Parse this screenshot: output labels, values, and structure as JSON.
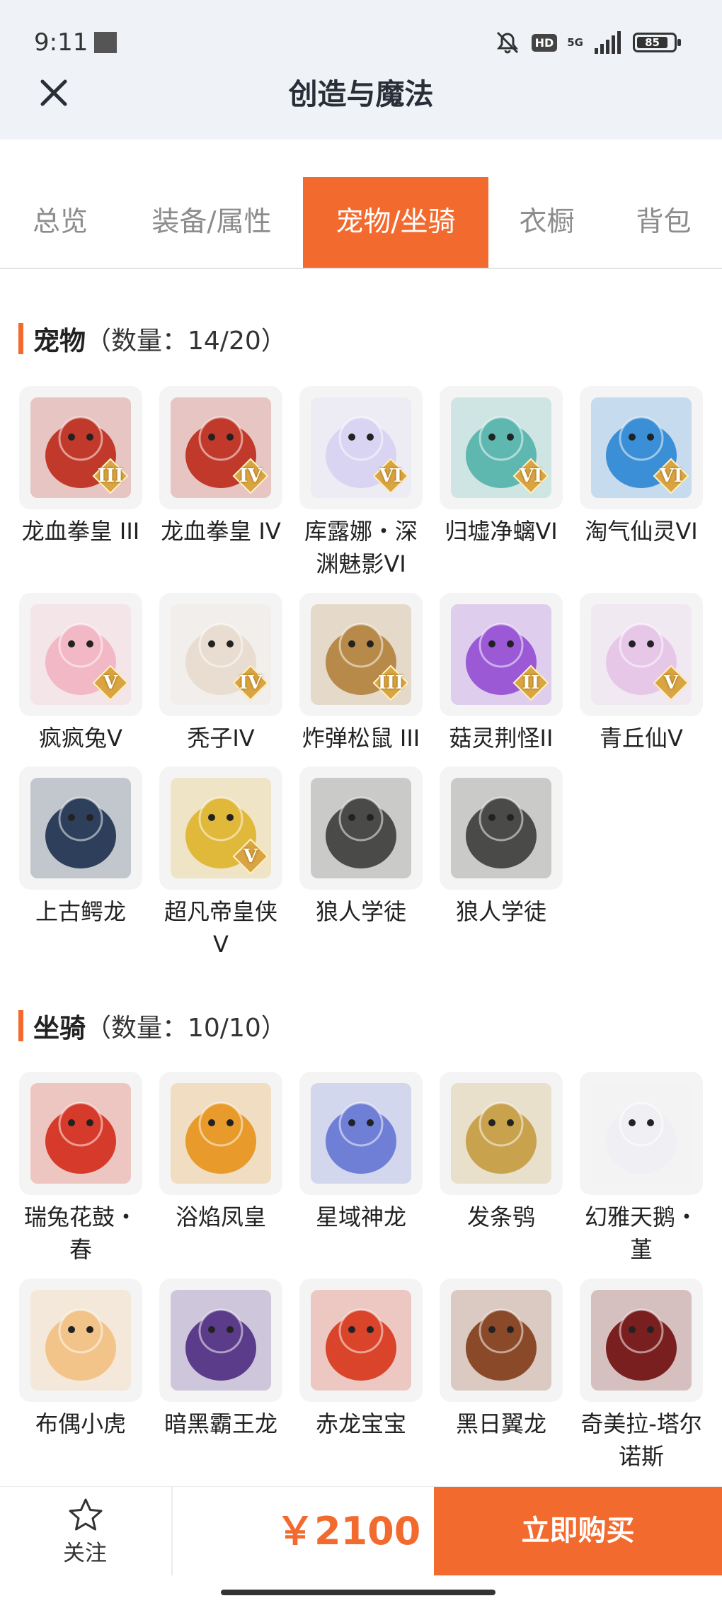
{
  "status_bar": {
    "time": "9:11",
    "hd": "HD",
    "network": "5G",
    "battery": "85"
  },
  "header": {
    "title": "创造与魔法"
  },
  "tabs": [
    {
      "label": "总览",
      "active": false
    },
    {
      "label": "装备/属性",
      "active": false
    },
    {
      "label": "宠物/坐骑",
      "active": true
    },
    {
      "label": "衣橱",
      "active": false
    },
    {
      "label": "背包",
      "active": false
    }
  ],
  "pets": {
    "title": "宠物",
    "count": "（数量：14/20）",
    "items": [
      {
        "name": "龙血拳皇 III",
        "grade": "III",
        "icon": "red-horned-beast-icon",
        "color": "#c0392b"
      },
      {
        "name": "龙血拳皇 IV",
        "grade": "IV",
        "icon": "red-horned-beast-icon",
        "color": "#c0392b"
      },
      {
        "name": "库露娜・深渊魅影VI",
        "grade": "VI",
        "icon": "white-haired-spirit-icon",
        "color": "#d9d4f2"
      },
      {
        "name": "归墟净螭VI",
        "grade": "VI",
        "icon": "teal-dragon-icon",
        "color": "#5fb8b0"
      },
      {
        "name": "淘气仙灵VI",
        "grade": "VI",
        "icon": "blue-pup-icon",
        "color": "#3a8fd6"
      },
      {
        "name": "疯疯兔V",
        "grade": "V",
        "icon": "pink-rabbit-icon",
        "color": "#f2b8c6"
      },
      {
        "name": "秃子IV",
        "grade": "IV",
        "icon": "bald-doll-icon",
        "color": "#e8ddd0"
      },
      {
        "name": "炸弹松鼠 III",
        "grade": "III",
        "icon": "squirrel-icon",
        "color": "#b88a4a"
      },
      {
        "name": "菇灵荆怪II",
        "grade": "II",
        "icon": "mushroom-sprite-icon",
        "color": "#9b59d6"
      },
      {
        "name": "青丘仙V",
        "grade": "V",
        "icon": "fox-fairy-icon",
        "color": "#e7c7e8"
      },
      {
        "name": "上古鳄龙",
        "grade": "",
        "icon": "dark-crocodile-dragon-icon",
        "color": "#2d3f5a"
      },
      {
        "name": "超凡帝皇侠V",
        "grade": "V",
        "icon": "golden-armor-icon",
        "color": "#e0b83a"
      },
      {
        "name": "狼人学徒",
        "grade": "",
        "icon": "werewolf-icon",
        "color": "#4a4a48"
      },
      {
        "name": "狼人学徒",
        "grade": "",
        "icon": "werewolf-icon",
        "color": "#4a4a48"
      }
    ]
  },
  "mounts": {
    "title": "坐骑",
    "count": "（数量：10/10）",
    "items": [
      {
        "name": "瑞兔花鼓・春",
        "icon": "red-drum-icon",
        "color": "#d63a2a"
      },
      {
        "name": "浴焰凤皇",
        "icon": "phoenix-icon",
        "color": "#e89a2a"
      },
      {
        "name": "星域神龙",
        "icon": "blue-dragon-icon",
        "color": "#6f7fd6"
      },
      {
        "name": "发条鸮",
        "icon": "clockwork-owl-icon",
        "color": "#c9a24e"
      },
      {
        "name": "幻雅天鹅・堇",
        "icon": "swan-icon",
        "color": "#f0f0f4"
      },
      {
        "name": "布偶小虎",
        "icon": "toy-tiger-icon",
        "color": "#f2c48a"
      },
      {
        "name": "暗黑霸王龙",
        "icon": "dark-trex-icon",
        "color": "#5b3c8a"
      },
      {
        "name": "赤龙宝宝",
        "icon": "baby-red-dragon-icon",
        "color": "#d9442a"
      },
      {
        "name": "黑日翼龙",
        "icon": "pterodactyl-icon",
        "color": "#8a4a2a"
      },
      {
        "name": "奇美拉-塔尔诺斯",
        "icon": "chimera-icon",
        "color": "#7a1f1f"
      }
    ]
  },
  "bottom_bar": {
    "follow_label": "关注",
    "price": "￥2100",
    "buy_label": "立即购买"
  },
  "colors": {
    "accent": "#f26a2e",
    "header_bg": "#eff3f7",
    "tile_bg": "#f4f4f4",
    "grade_badge": "#d9a441"
  }
}
